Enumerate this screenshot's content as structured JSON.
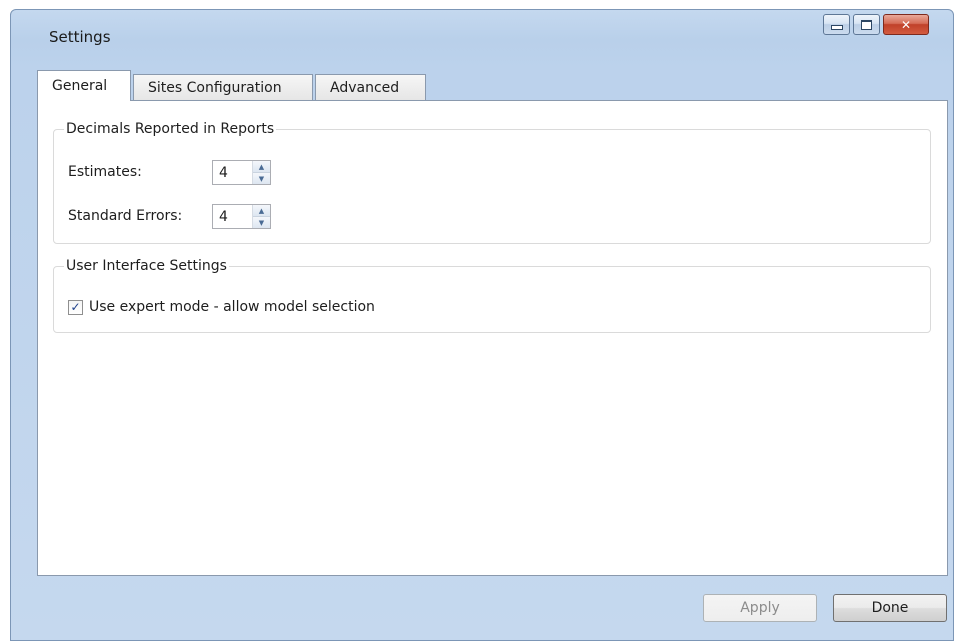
{
  "window": {
    "title": "Settings",
    "caption_buttons": {
      "minimize": "minimize",
      "maximize": "maximize",
      "close": "✕"
    }
  },
  "tabs": [
    {
      "label": "General",
      "active": true
    },
    {
      "label": "Sites Configuration",
      "active": false
    },
    {
      "label": "Advanced",
      "active": false
    }
  ],
  "decimals_group": {
    "legend": "Decimals Reported in Reports",
    "estimates": {
      "label": "Estimates:",
      "value": "4"
    },
    "standard_errors": {
      "label": "Standard Errors:",
      "value": "4"
    }
  },
  "ui_group": {
    "legend": "User Interface Settings",
    "expert_mode": {
      "label": "Use expert mode - allow model selection",
      "checked": true
    }
  },
  "buttons": {
    "apply": {
      "label": "Apply",
      "enabled": false
    },
    "done": {
      "label": "Done",
      "enabled": true
    }
  },
  "colors": {
    "title_bar": "#bcd2ec",
    "close_button": "#c0412a",
    "checkmark": "#1d3f8a"
  }
}
